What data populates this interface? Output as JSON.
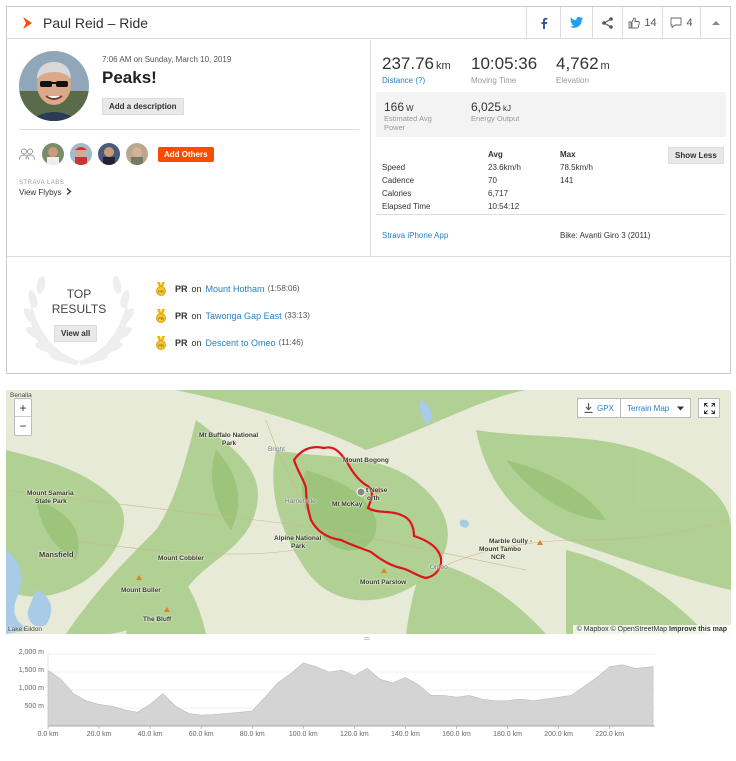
{
  "header": {
    "title": "Paul Reid – Ride",
    "kudos_count": "14",
    "comment_count": "4"
  },
  "activity": {
    "date": "7:06 AM on Sunday, March 10, 2019",
    "name": "Peaks!",
    "add_description": "Add a description",
    "add_others": "Add Others",
    "labs_label": "STRAVA LABS",
    "view_flybys": "View Flybys"
  },
  "stats": {
    "distance": {
      "value": "237.76",
      "unit": "km",
      "label": "Distance (?)"
    },
    "moving_time": {
      "value": "10:05:36",
      "label": "Moving Time"
    },
    "elevation": {
      "value": "4,762",
      "unit": "m",
      "label": "Elevation"
    },
    "power": {
      "value": "166",
      "unit": "W",
      "label_line1": "Estimated Avg",
      "label_line2": "Power"
    },
    "energy": {
      "value": "6,025",
      "unit": "kJ",
      "label": "Energy Output"
    },
    "show_less": "Show Less",
    "table_headers": {
      "avg": "Avg",
      "max": "Max"
    },
    "rows": [
      {
        "label": "Speed",
        "avg": "23.6km/h",
        "max": "78.5km/h"
      },
      {
        "label": "Cadence",
        "avg": "70",
        "max": "141"
      },
      {
        "label": "Calories",
        "avg": "6,717",
        "max": ""
      },
      {
        "label": "Elapsed Time",
        "avg": "10:54:12",
        "max": ""
      }
    ],
    "device": "Strava iPhone App",
    "bike": "Bike: Avanti Giro 3 (2011)"
  },
  "top_results": {
    "title_line1": "TOP",
    "title_line2": "RESULTS",
    "view_all": "View all",
    "items": [
      {
        "badge": "PR",
        "on": "on",
        "segment": "Mount Hotham",
        "time": "(1:58:06)"
      },
      {
        "badge": "PR",
        "on": "on",
        "segment": "Tawonga Gap East",
        "time": "(33:13)"
      },
      {
        "badge": "PR",
        "on": "on",
        "segment": "Descent to Omeo",
        "time": "(11:46)"
      }
    ]
  },
  "map": {
    "gpx": "GPX",
    "terrain": "Terrain Map",
    "zoom_in": "+",
    "zoom_out": "−",
    "attribution_mapbox": "© Mapbox",
    "attribution_osm": "© OpenStreetMap",
    "improve": "Improve this map",
    "labels": {
      "benalla": "Benalla",
      "buffalo": "Mt Buffalo National",
      "park": "Park",
      "bright": "Bright",
      "bogong": "Mount Bogong",
      "nelse": "t Nelse",
      "north": "orth",
      "mckay": "Mt McKay",
      "harrietville": "Harrietville",
      "alpine": "Alpine National",
      "alpine_park": "Park",
      "samaria": "Mount Samaria",
      "samaria2": "State Park",
      "mansfield": "Mansfield",
      "cobbler": "Mount Cobbler",
      "buller": "Mount Buller",
      "bluff": "The Bluff",
      "eildon": "Lake Eildon",
      "parslow": "Mount Parslow",
      "omeo": "Omeo",
      "marble": "Marble Gully -",
      "tambo": "Mount Tambo",
      "ncr": "NCR"
    }
  },
  "chart_data": {
    "type": "area",
    "xlabel": "",
    "ylabel": "",
    "x": [
      0,
      5,
      10,
      15,
      20,
      25,
      30,
      35,
      40,
      45,
      50,
      55,
      60,
      65,
      70,
      75,
      80,
      85,
      90,
      95,
      100,
      105,
      110,
      115,
      120,
      125,
      130,
      135,
      140,
      145,
      150,
      155,
      160,
      165,
      170,
      175,
      180,
      185,
      190,
      195,
      200,
      205,
      210,
      215,
      220,
      225,
      230,
      237
    ],
    "values": [
      1550,
      1300,
      900,
      700,
      600,
      550,
      450,
      380,
      600,
      900,
      550,
      350,
      300,
      320,
      350,
      380,
      420,
      800,
      1200,
      1450,
      1750,
      1650,
      1500,
      1550,
      1400,
      1600,
      1300,
      1200,
      1350,
      1150,
      850,
      850,
      800,
      850,
      750,
      700,
      700,
      750,
      700,
      750,
      800,
      850,
      1100,
      1350,
      1650,
      1700,
      1600,
      1650
    ],
    "xlim": [
      0,
      237.76
    ],
    "ylim": [
      0,
      2000
    ],
    "yticks": [
      "2,000 m",
      "1,500 m",
      "1,000 m",
      "500 m"
    ],
    "xticks": [
      "0.0 km",
      "20.0 km",
      "40.0 km",
      "60.0 km",
      "80.0 km",
      "100.0 km",
      "120.0 km",
      "140.0 km",
      "160.0 km",
      "180.0 km",
      "200.0 km",
      "220.0 km"
    ],
    "grid": true
  }
}
